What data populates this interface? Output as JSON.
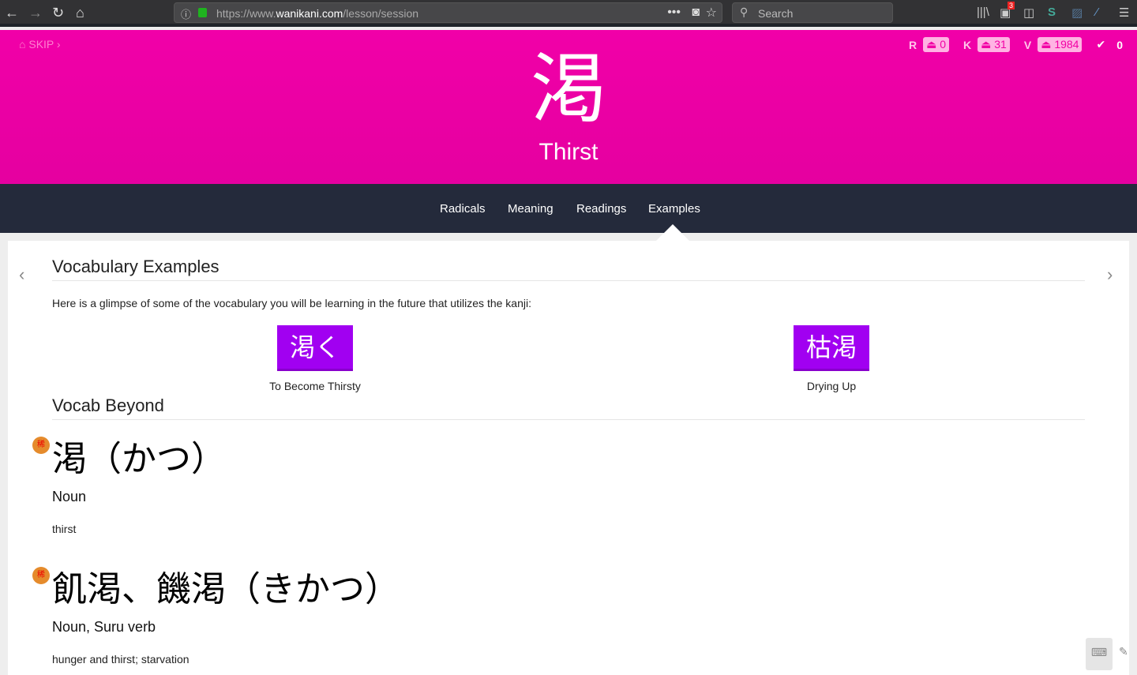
{
  "browser": {
    "url_prefix": "https://www.",
    "url_domain": "wanikani.com",
    "url_path": "/lesson/session",
    "search_placeholder": "Search",
    "ext_badge": "3"
  },
  "header": {
    "skip_label": "SKIP",
    "kanji": "渇",
    "meaning": "Thirst",
    "stats": {
      "r_label": "R",
      "r_count": "0",
      "k_label": "K",
      "k_count": "31",
      "v_label": "V",
      "v_count": "1984",
      "done_count": "0"
    }
  },
  "nav": {
    "tabs": [
      "Radicals",
      "Meaning",
      "Readings",
      "Examples"
    ],
    "active": "Examples"
  },
  "content": {
    "examples_title": "Vocabulary Examples",
    "examples_desc": "Here is a glimpse of some of the vocabulary you will be learning in the future that utilizes the kanji:",
    "vocab": [
      {
        "word": "渇く",
        "meaning": "To Become Thirsty"
      },
      {
        "word": "枯渇",
        "meaning": "Drying Up"
      }
    ],
    "beyond_title": "Vocab Beyond",
    "beyond": [
      {
        "word": "渇（かつ）",
        "pos": "Noun",
        "gloss": "thirst",
        "rare": "稀"
      },
      {
        "word": "飢渇、饑渇（きかつ）",
        "pos": "Noun, Suru verb",
        "gloss": "hunger and thirst; starvation",
        "rare": "稀"
      }
    ]
  }
}
